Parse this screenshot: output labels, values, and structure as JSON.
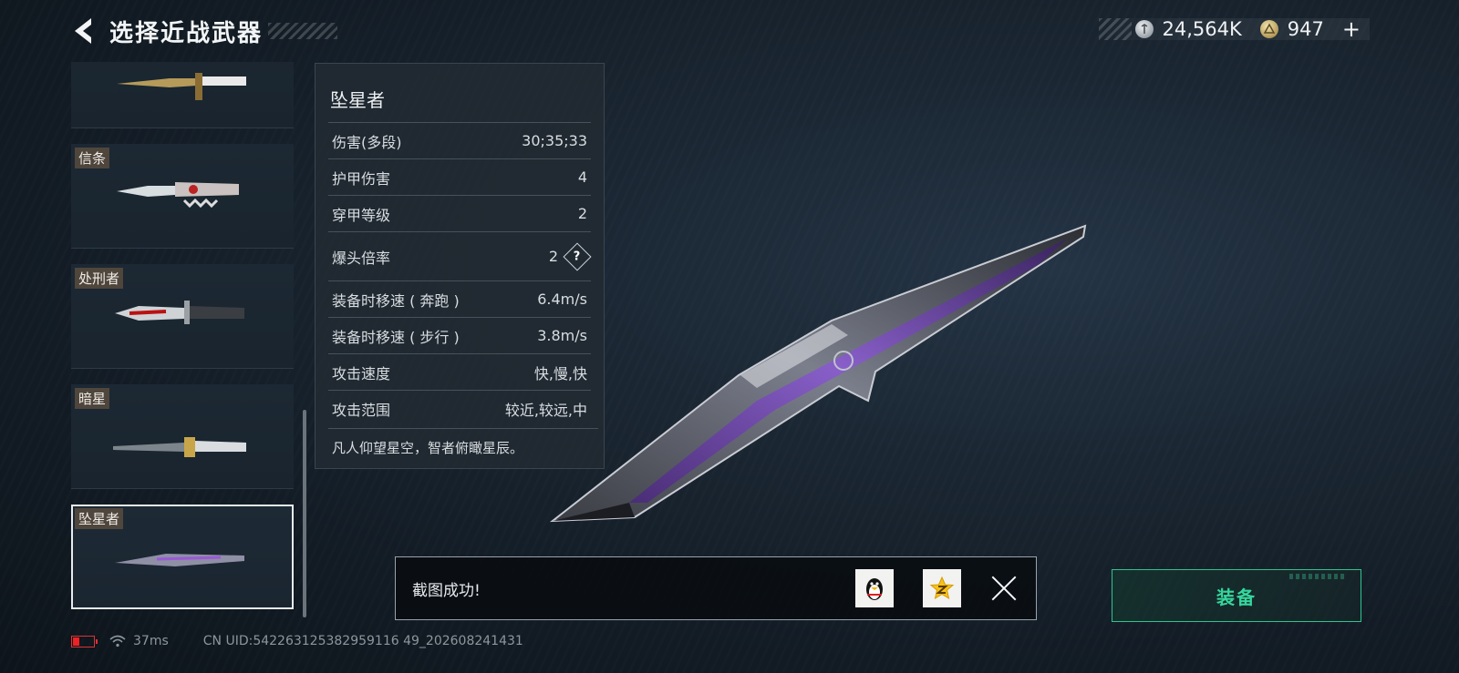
{
  "header": {
    "title": "选择近战武器"
  },
  "currency": {
    "silver_value": "24,564K",
    "gold_value": "947",
    "plus": "+"
  },
  "weapon_list": [
    {
      "label": "",
      "selected": false
    },
    {
      "label": "信条",
      "selected": false
    },
    {
      "label": "处刑者",
      "selected": false
    },
    {
      "label": "暗星",
      "selected": false
    },
    {
      "label": "坠星者",
      "selected": true
    }
  ],
  "stats": {
    "name": "坠星者",
    "rows": [
      {
        "key": "伤害(多段)",
        "value": "30;35;33"
      },
      {
        "key": "护甲伤害",
        "value": "4"
      },
      {
        "key": "穿甲等级",
        "value": "2"
      },
      {
        "key": "爆头倍率",
        "value": "2"
      },
      {
        "key": "装备时移速 ( 奔跑 )",
        "value": "6.4m/s"
      },
      {
        "key": "装备时移速 ( 步行 )",
        "value": "3.8m/s"
      },
      {
        "key": "攻击速度",
        "value": "快,慢,快"
      },
      {
        "key": "攻击范围",
        "value": "较近,较远,中"
      }
    ],
    "help_glyph": "?",
    "description": "凡人仰望星空，智者俯瞰星辰。"
  },
  "toast": {
    "message": "截图成功!"
  },
  "equip": {
    "label": "装备"
  },
  "status_bar": {
    "ping": "37ms",
    "uid": "CN UID:542263125382959116 49_202608241431"
  },
  "colors": {
    "accent_green": "#35d79c",
    "battery_red": "#e22"
  }
}
